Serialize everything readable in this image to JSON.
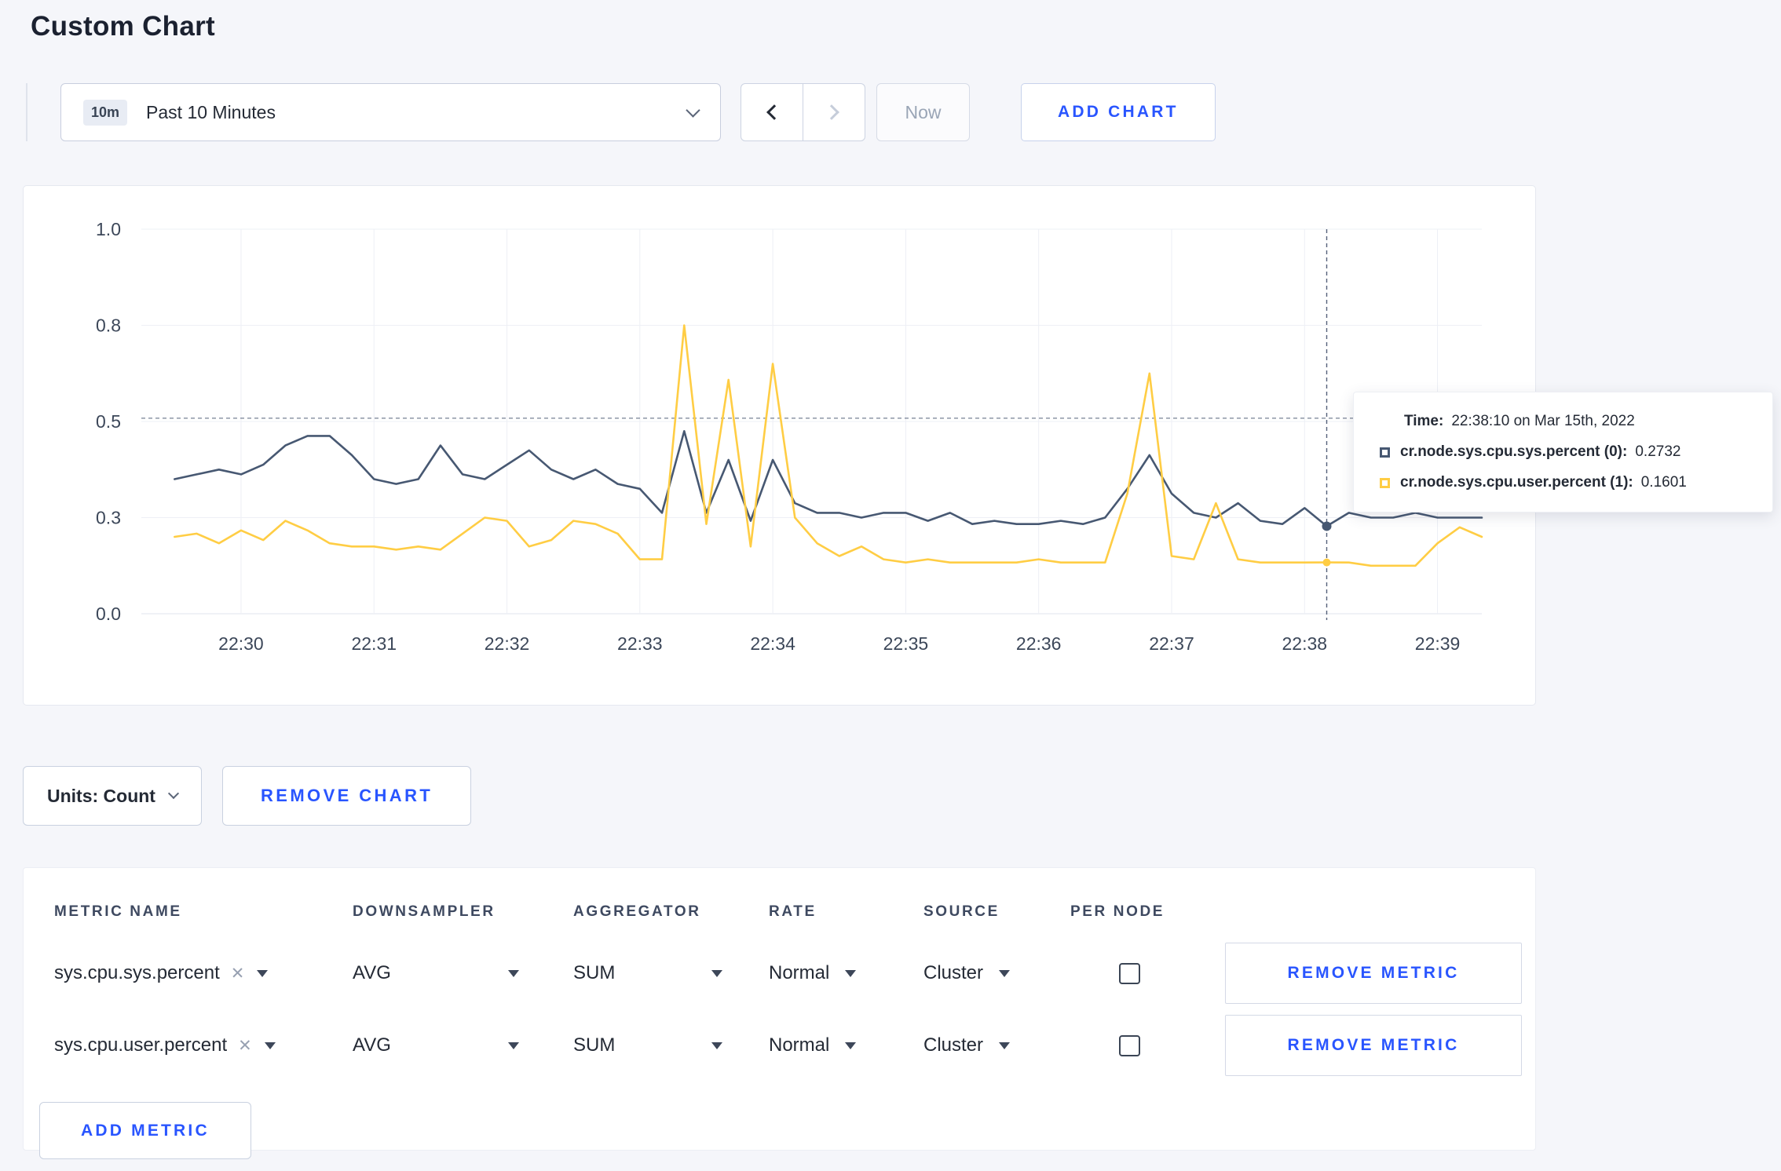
{
  "colors": {
    "accent": "#2955ff",
    "series_sys": "#475872",
    "series_user": "#ffcd44"
  },
  "icons": {
    "clear": "✕"
  },
  "page": {
    "title": "Custom Chart"
  },
  "controls": {
    "time_badge": "10m",
    "time_label": "Past 10 Minutes",
    "now_label": "Now",
    "add_chart_label": "ADD CHART"
  },
  "toolbar": {
    "units_label": "Units: Count",
    "remove_chart_label": "REMOVE CHART"
  },
  "metrics": {
    "headers": [
      "METRIC NAME",
      "DOWNSAMPLER",
      "AGGREGATOR",
      "RATE",
      "SOURCE",
      "PER NODE"
    ],
    "rows": [
      {
        "metric": "sys.cpu.sys.percent",
        "downsampler": "AVG",
        "aggregator": "SUM",
        "rate": "Normal",
        "source": "Cluster",
        "per_node_checked": false,
        "remove_label": "REMOVE METRIC"
      },
      {
        "metric": "sys.cpu.user.percent",
        "downsampler": "AVG",
        "aggregator": "SUM",
        "rate": "Normal",
        "source": "Cluster",
        "per_node_checked": false,
        "remove_label": "REMOVE METRIC"
      }
    ],
    "add_metric_label": "ADD METRIC"
  },
  "chart_data": {
    "type": "line",
    "title": "",
    "x_start_time": "22:29:30",
    "x_step_s": 10,
    "x_offset_s": 15,
    "x_span_s": 605,
    "x_ticks": [
      "22:30",
      "22:31",
      "22:32",
      "22:33",
      "22:34",
      "22:35",
      "22:36",
      "22:37",
      "22:38",
      "22:39"
    ],
    "x_tick_first_offset_s": 45,
    "x_tick_step_s": 60,
    "y_ticks": [
      0.0,
      0.3,
      0.5,
      0.8,
      1.0
    ],
    "y_tick_labels": [
      "0.0",
      "0.3",
      "0.5",
      "0.8",
      "1.0"
    ],
    "grid": true,
    "legend_position": "none",
    "series": [
      {
        "name": "cr.node.sys.cpu.sys.percent",
        "color": "#475872",
        "values": [
          0.38,
          0.39,
          0.4,
          0.39,
          0.41,
          0.45,
          0.47,
          0.47,
          0.43,
          0.38,
          0.37,
          0.38,
          0.45,
          0.39,
          0.38,
          0.41,
          0.44,
          0.4,
          0.38,
          0.4,
          0.37,
          0.36,
          0.31,
          0.48,
          0.31,
          0.42,
          0.29,
          0.42,
          0.33,
          0.31,
          0.31,
          0.3,
          0.31,
          0.31,
          0.29,
          0.31,
          0.28,
          0.29,
          0.28,
          0.28,
          0.29,
          0.28,
          0.3,
          0.36,
          0.43,
          0.35,
          0.31,
          0.3,
          0.33,
          0.29,
          0.28,
          0.32,
          0.2732,
          0.31,
          0.3,
          0.3,
          0.31,
          0.3,
          0.3,
          0.3
        ]
      },
      {
        "name": "cr.node.sys.cpu.user.percent",
        "color": "#ffcd44",
        "values": [
          0.24,
          0.25,
          0.22,
          0.26,
          0.23,
          0.29,
          0.26,
          0.22,
          0.21,
          0.21,
          0.2,
          0.21,
          0.2,
          0.25,
          0.3,
          0.29,
          0.21,
          0.23,
          0.29,
          0.28,
          0.25,
          0.17,
          0.17,
          0.8,
          0.28,
          0.63,
          0.21,
          0.68,
          0.3,
          0.22,
          0.18,
          0.21,
          0.17,
          0.16,
          0.17,
          0.16,
          0.16,
          0.16,
          0.16,
          0.17,
          0.16,
          0.16,
          0.16,
          0.35,
          0.65,
          0.18,
          0.17,
          0.33,
          0.17,
          0.16,
          0.16,
          0.16,
          0.1601,
          0.16,
          0.15,
          0.15,
          0.15,
          0.22,
          0.27,
          0.24
        ]
      }
    ],
    "crosshair": {
      "index": 52,
      "time": "22:38:10",
      "hline_value": 0.51
    },
    "tooltip": {
      "time_label": "Time:",
      "time_value": "22:38:10 on Mar 15th, 2022",
      "entries": [
        {
          "label": "cr.node.sys.cpu.sys.percent (0):",
          "value": "0.2732",
          "color": "#475872"
        },
        {
          "label": "cr.node.sys.cpu.user.percent (1):",
          "value": "0.1601",
          "color": "#ffcd44"
        }
      ]
    }
  }
}
